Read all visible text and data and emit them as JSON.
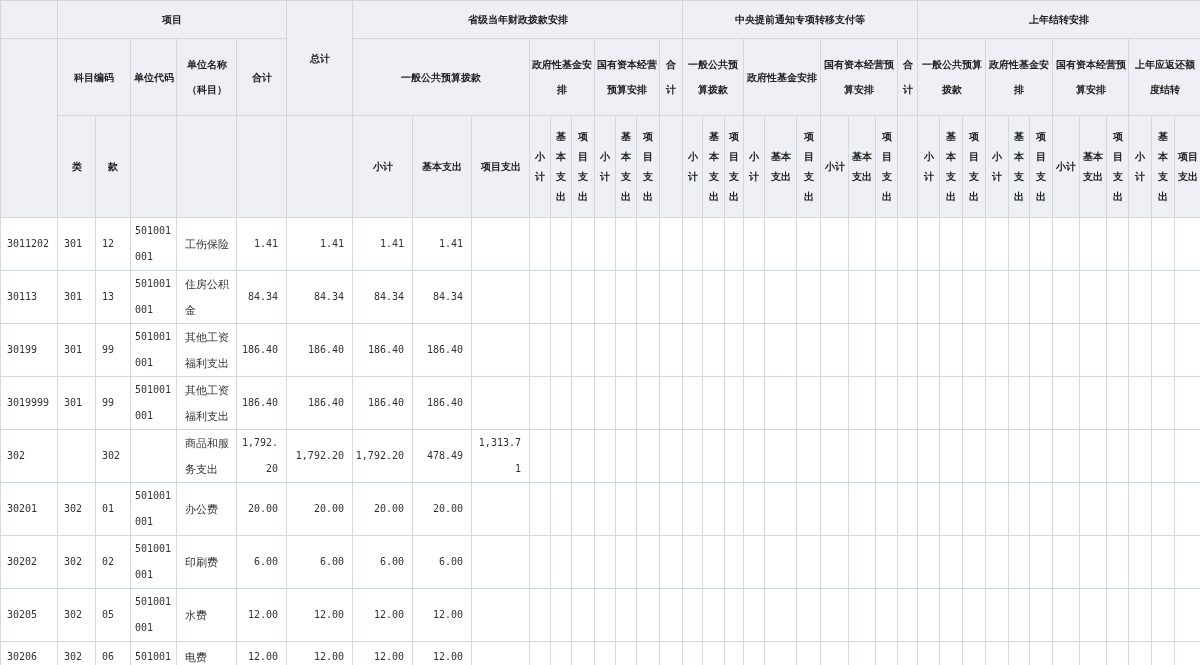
{
  "header": {
    "row_1": [
      "项目",
      "总计",
      "省级当年财政拨款安排",
      "中央提前通知专项转移支付等",
      "上年结转安排"
    ],
    "row_2": [
      "科目编码",
      "单位代码",
      "单位名称（科目）",
      "合计",
      "一般公共预算拨款",
      "政府性基金安排",
      "国有资本经营预算安排",
      "合计",
      "一般公共预算拨款",
      "政府性基金安排",
      "国有资本经营预算安排",
      "合计",
      "一般公共预算拨款",
      "政府性基金安排",
      "国有资本经营预算安排",
      "上年应返还额度结转"
    ],
    "row_3": [
      "类",
      "款",
      "小计",
      "基本支出",
      "项目支出",
      "小计",
      "基本支出",
      "项目支出",
      "小计",
      "基本支出",
      "项目支出",
      "小计",
      "基本支出",
      "项目支出",
      "小计",
      "基本支出",
      "项目支出",
      "小计",
      "基本支出",
      "项目支出",
      "小计",
      "基本支出",
      "项目支出",
      "小计",
      "基本支出",
      "项目支出",
      "小计",
      "基本支出",
      "项目支出",
      "小计",
      "基本支出",
      "项目支出"
    ]
  },
  "rows": [
    {
      "code": "3011202",
      "class": "301",
      "item": "12",
      "unit_code": "501001001",
      "unit_name": "工伤保险",
      "total": "1.41",
      "sum": "1.41",
      "subtotal": "1.41",
      "basic": "1.41"
    },
    {
      "code": "30113",
      "class": "301",
      "item": "13",
      "unit_code": "501001001",
      "unit_name": "住房公积金",
      "total": "84.34",
      "sum": "84.34",
      "subtotal": "84.34",
      "basic": "84.34"
    },
    {
      "code": "30199",
      "class": "301",
      "item": "99",
      "unit_code": "501001001",
      "unit_name": "其他工资福利支出",
      "total": "186.40",
      "sum": "186.40",
      "subtotal": "186.40",
      "basic": "186.40"
    },
    {
      "code": "3019999",
      "class": "301",
      "item": "99",
      "unit_code": "501001001",
      "unit_name": "其他工资福利支出",
      "total": "186.40",
      "sum": "186.40",
      "subtotal": "186.40",
      "basic": "186.40"
    },
    {
      "code": "302",
      "item": "302",
      "unit_name": "商品和服务支出",
      "total": "1,792.20",
      "sum": "1,792.20",
      "subtotal": "1,792.20",
      "basic": "478.49",
      "project": "1,313.71"
    },
    {
      "code": "30201",
      "class": "302",
      "item": "01",
      "unit_code": "501001001",
      "unit_name": "办公费",
      "total": "20.00",
      "sum": "20.00",
      "subtotal": "20.00",
      "basic": "20.00"
    },
    {
      "code": "30202",
      "class": "302",
      "item": "02",
      "unit_code": "501001001",
      "unit_name": "印刷费",
      "total": "6.00",
      "sum": "6.00",
      "subtotal": "6.00",
      "basic": "6.00"
    },
    {
      "code": "30205",
      "class": "302",
      "item": "05",
      "unit_code": "501001001",
      "unit_name": "水费",
      "total": "12.00",
      "sum": "12.00",
      "subtotal": "12.00",
      "basic": "12.00"
    },
    {
      "code": "30206",
      "class": "302",
      "item": "06",
      "unit_code": "501001",
      "unit_name": "电费",
      "total": "12.00",
      "sum": "12.00",
      "subtotal": "12.00",
      "basic": "12.00"
    }
  ]
}
